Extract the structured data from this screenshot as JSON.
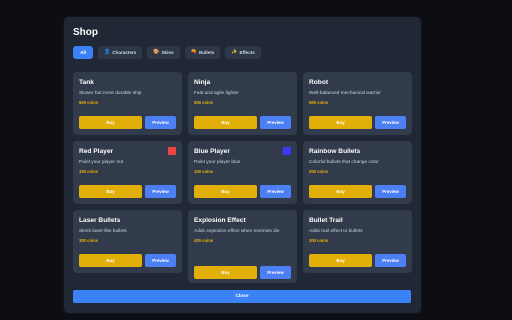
{
  "shop": {
    "title": "Shop",
    "tabs": [
      {
        "label": "All",
        "icon": ""
      },
      {
        "label": "Characters",
        "icon": "👤"
      },
      {
        "label": "Skins",
        "icon": "🎨"
      },
      {
        "label": "Bullets",
        "icon": "🔫"
      },
      {
        "label": "Effects",
        "icon": "✨"
      }
    ],
    "items": [
      {
        "name": "Tank",
        "desc": "Slower but more durable ship",
        "price": "500 coins",
        "swatch": ""
      },
      {
        "name": "Ninja",
        "desc": "Fast and agile fighter",
        "price": "500 coins",
        "swatch": ""
      },
      {
        "name": "Robot",
        "desc": "Well-balanced mechanical warrior",
        "price": "600 coins",
        "swatch": ""
      },
      {
        "name": "Red Player",
        "desc": "Paint your player red",
        "price": "100 coins",
        "swatch": "#ef4444"
      },
      {
        "name": "Blue Player",
        "desc": "Paint your player blue",
        "price": "100 coins",
        "swatch": "#3b3bf6"
      },
      {
        "name": "Rainbow Bullets",
        "desc": "Colorful bullets that change color",
        "price": "200 coins",
        "swatch": ""
      },
      {
        "name": "Laser Bullets",
        "desc": "Sleek laser-like bullets",
        "price": "300 coins",
        "swatch": ""
      },
      {
        "name": "Explosion Effect",
        "desc": "Adds explosion effect when enemies die",
        "price": "400 coins",
        "swatch": ""
      },
      {
        "name": "Bullet Trail",
        "desc": "Adds trail effect to bullets",
        "price": "300 coins",
        "swatch": ""
      }
    ],
    "buy_label": "Buy",
    "preview_label": "Preview",
    "close_label": "Close"
  }
}
